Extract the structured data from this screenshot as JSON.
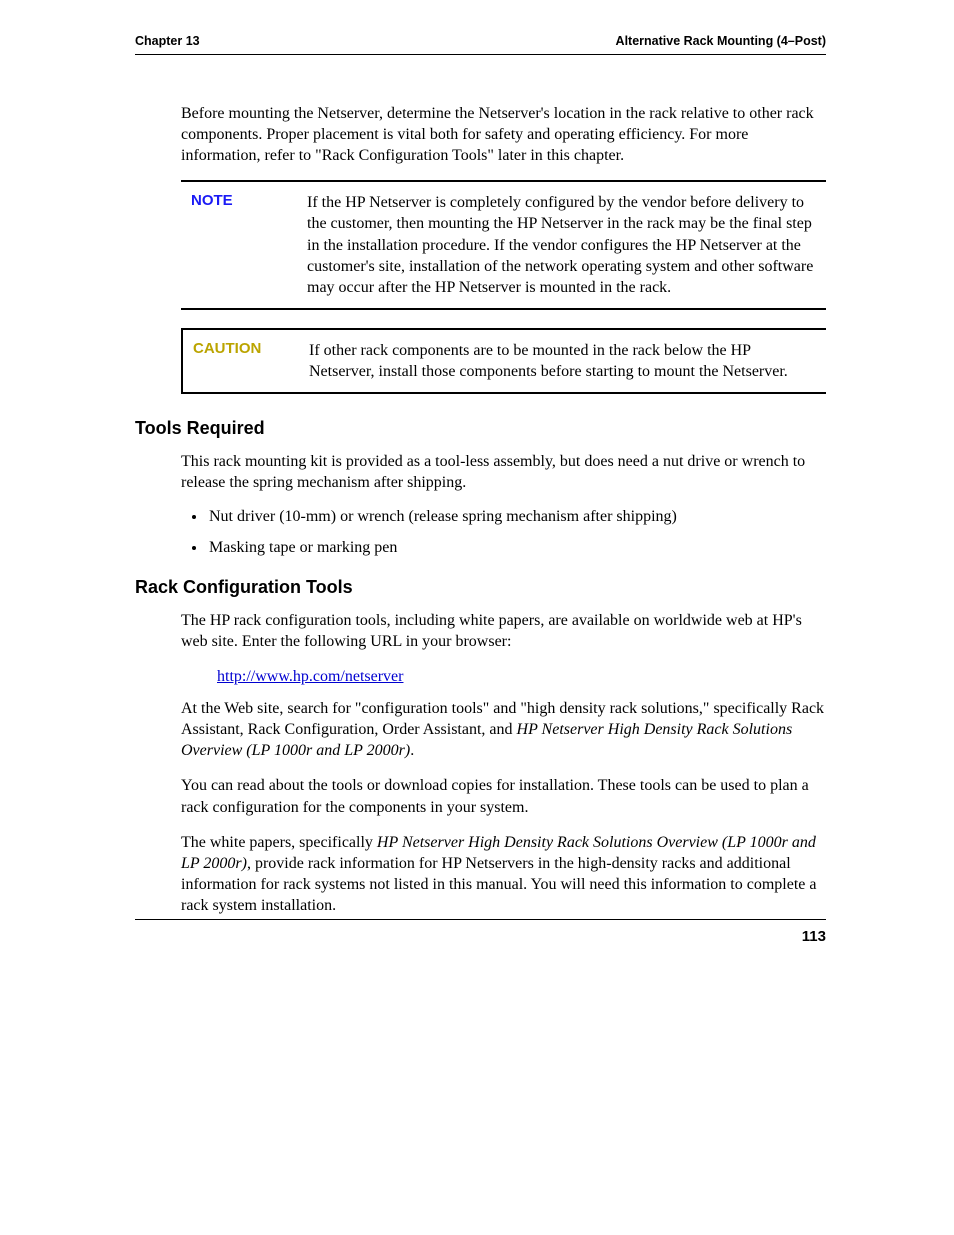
{
  "header": {
    "left": "Chapter 13",
    "right": "Alternative Rack Mounting (4–Post)"
  },
  "intro": "Before mounting the Netserver, determine the Netserver's location in the rack relative to other rack components. Proper placement is vital both for safety and operating efficiency.  For more information, refer to \"Rack Configuration Tools\" later in this chapter.",
  "note": {
    "label": "NOTE",
    "body": "If the HP Netserver is completely configured by the vendor before delivery to the customer, then mounting the HP Netserver in the rack may be the final step in the installation procedure. If the vendor configures the HP Netserver at the customer's site, installation of the network operating system and other software may occur after the HP Netserver is mounted in the rack."
  },
  "caution": {
    "label": "CAUTION",
    "body": "If other rack components are to be mounted in the rack below the HP Netserver, install those components before starting to mount the Netserver."
  },
  "tools": {
    "heading": "Tools Required",
    "intro": "This rack mounting kit is provided as a tool-less assembly, but does need a nut drive or wrench to release the spring mechanism after shipping.",
    "items": [
      "Nut driver (10-mm) or wrench (release spring mechanism after shipping)",
      "Masking tape or marking pen"
    ]
  },
  "rct": {
    "heading": "Rack Configuration Tools",
    "p1": "The HP rack configuration tools, including white papers, are available on worldwide web at HP's web site.  Enter the following URL in your browser:",
    "url": "http://www.hp.com/netserver",
    "p2a": "At the Web site, search for \"configuration tools\" and \"high density rack solutions,\" specifically Rack Assistant, Rack Configuration, Order Assistant, and ",
    "p2i": "HP Netserver High Density Rack Solutions Overview (LP 1000r and LP 2000r)",
    "p2b": ".",
    "p3": "You can read about the tools or download copies for installation. These tools can be used to plan a rack configuration for the components in your system.",
    "p4a": "The white papers, specifically ",
    "p4i": "HP Netserver High Density Rack Solutions Overview (LP 1000r and LP 2000r)",
    "p4b": ", provide rack information for HP Netservers in the high-density racks and additional information for rack systems not listed in this manual. You will need this information to complete a rack system installation."
  },
  "pageNumber": "113"
}
